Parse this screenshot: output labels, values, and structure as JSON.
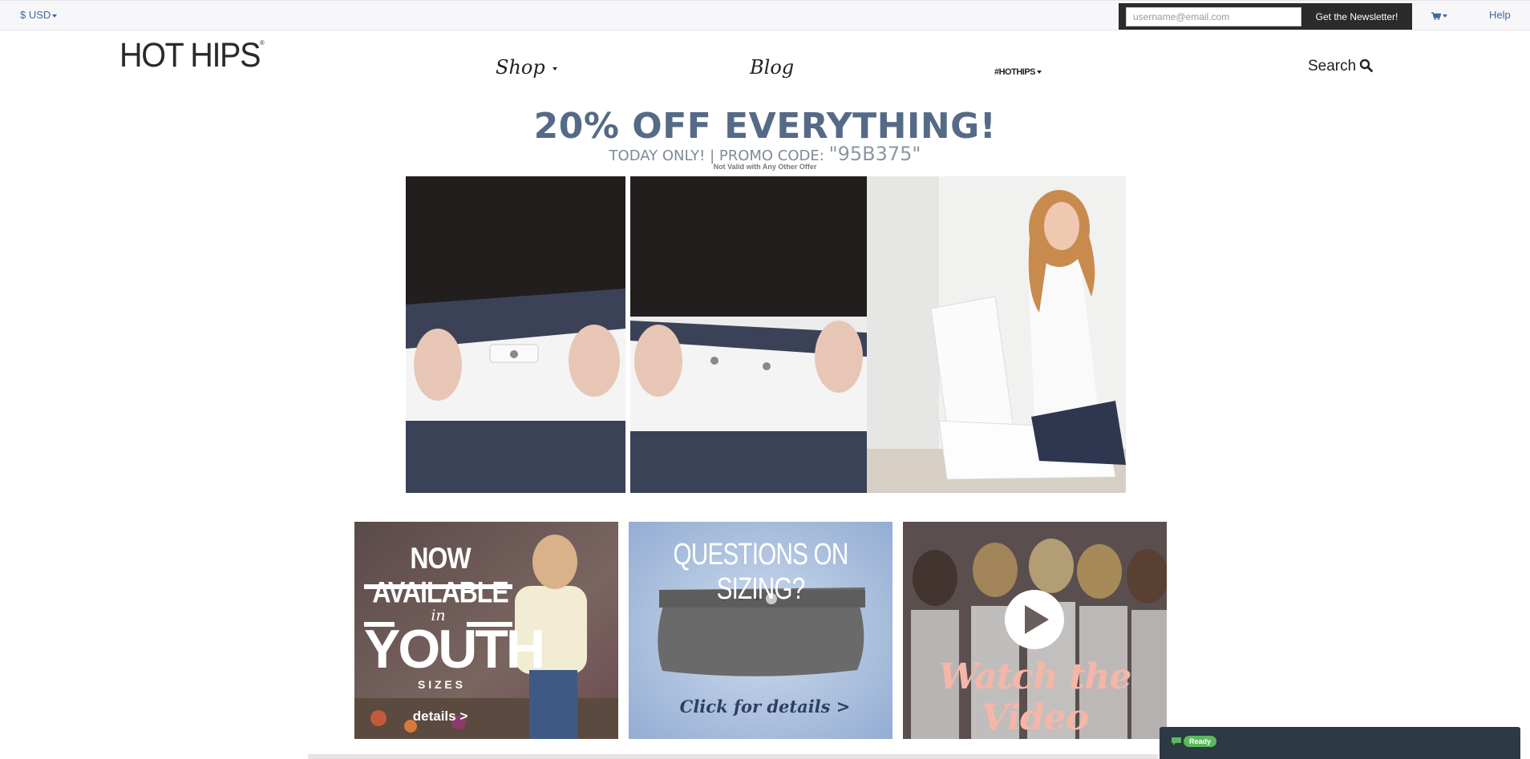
{
  "topbar": {
    "currency_label": "$ USD",
    "newsletter_placeholder": "username@email.com",
    "newsletter_button": "Get the Newsletter!",
    "help_label": "Help"
  },
  "header": {
    "logo_text": "HOT HIPS",
    "logo_mark": "®",
    "nav": {
      "shop": "Shop",
      "blog": "Blog",
      "hashtag": "#HOTHIPS",
      "search": "Search"
    }
  },
  "promo": {
    "headline": "20% OFF EVERYTHING!",
    "sub": "TODAY ONLY! | PROMO CODE: ",
    "code": "\"95B375\"",
    "note": "Not Valid with Any Other Offer"
  },
  "tiles": {
    "youth": {
      "line1": "NOW AVAILABLE",
      "line2": "in",
      "line3": "YOUTH",
      "line4": "S I Z E S",
      "link": "details >"
    },
    "sizing": {
      "title": "QUESTIONS ON SIZING?",
      "link": "Click for details >"
    },
    "video": {
      "title": "Watch the Video"
    }
  },
  "chat": {
    "status": "Ready"
  },
  "colors": {
    "link_blue": "#3d6a9a",
    "promo_slate": "#556a86",
    "dark_bar": "#2b2b2b",
    "chat_bg": "#2d3a44",
    "ready_green": "#5cb85c"
  }
}
